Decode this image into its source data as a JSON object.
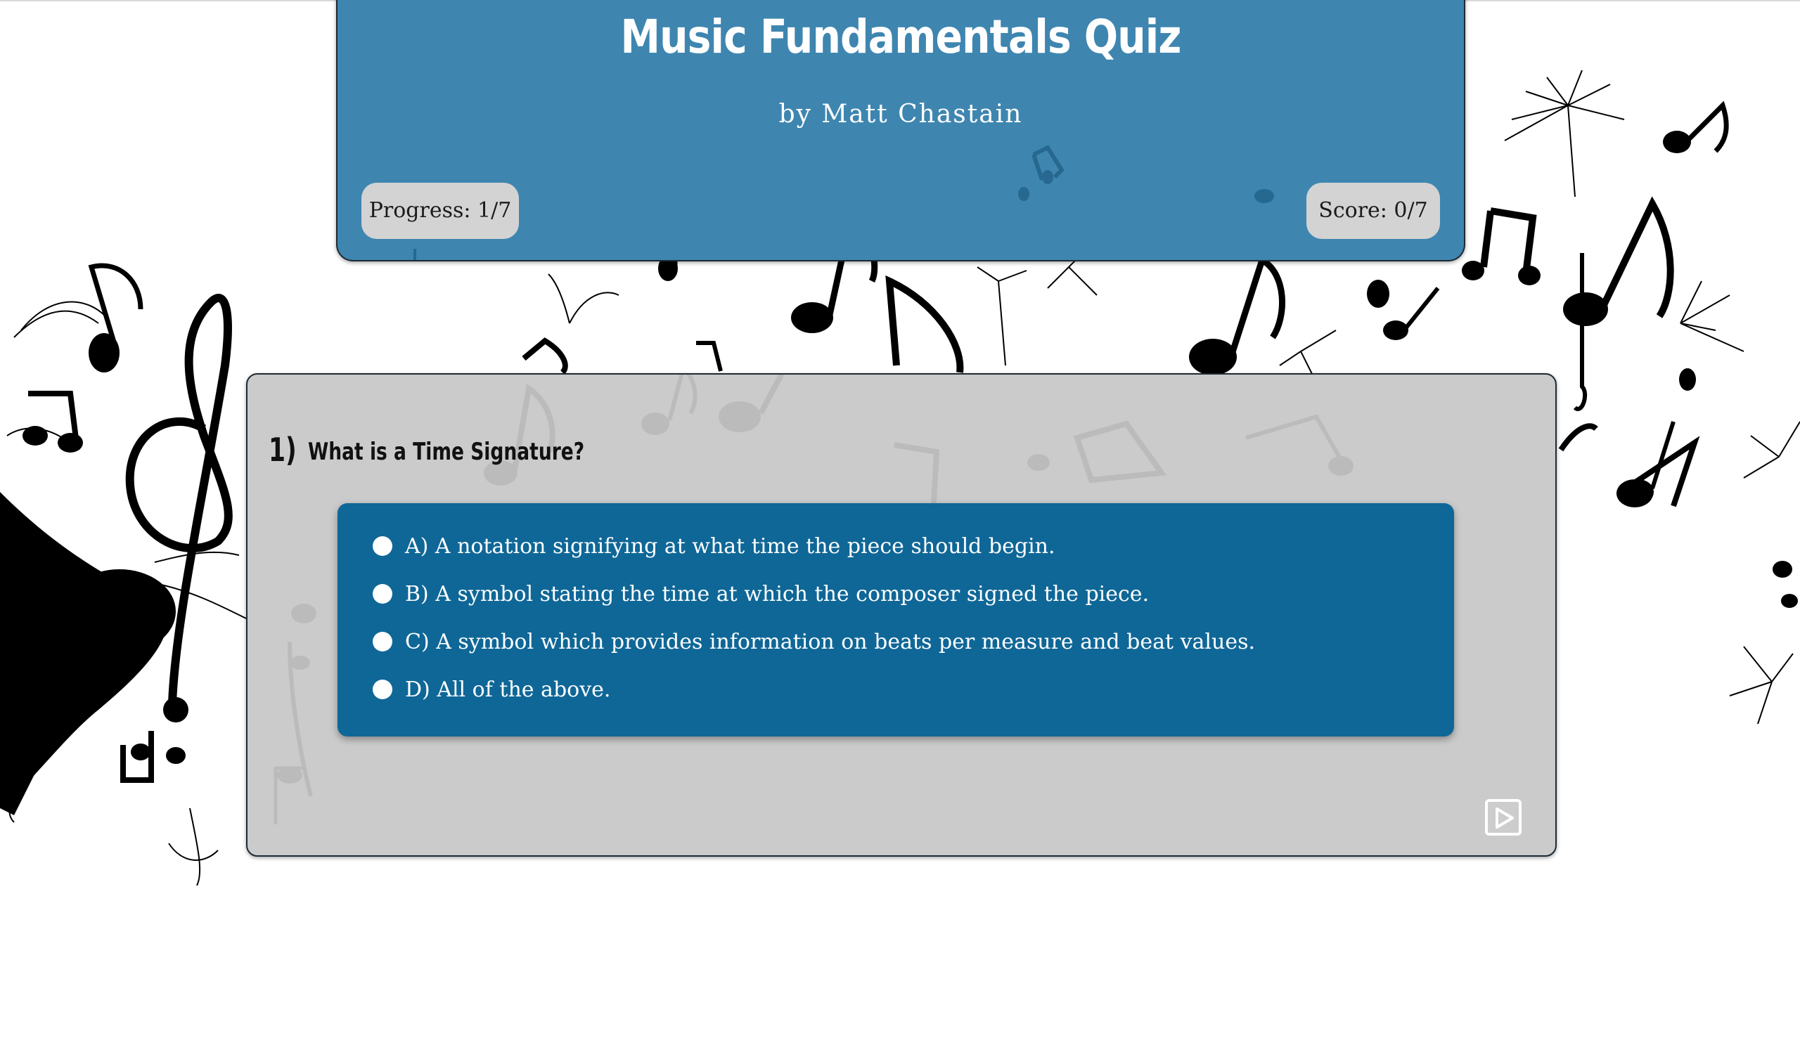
{
  "header": {
    "title": "Music Fundamentals Quiz",
    "author": "by Matt Chastain",
    "progress": "Progress: 1/7",
    "score": "Score: 0/7"
  },
  "question": {
    "number": "1)",
    "text": "What is a Time Signature?",
    "options": [
      {
        "label": "A) A notation signifying at what time the piece should begin."
      },
      {
        "label": "B) A symbol stating the time at which the composer signed the piece."
      },
      {
        "label": "C) A symbol which provides information on beats per measure and beat values."
      },
      {
        "label": "D) All of the above."
      }
    ],
    "next_icon": "play-next-icon"
  },
  "colors": {
    "header_bg": "#3e86b0",
    "panel_bg": "#cbcbcb",
    "answers_bg": "#0f6797",
    "badge_bg": "#d3d3d3"
  }
}
